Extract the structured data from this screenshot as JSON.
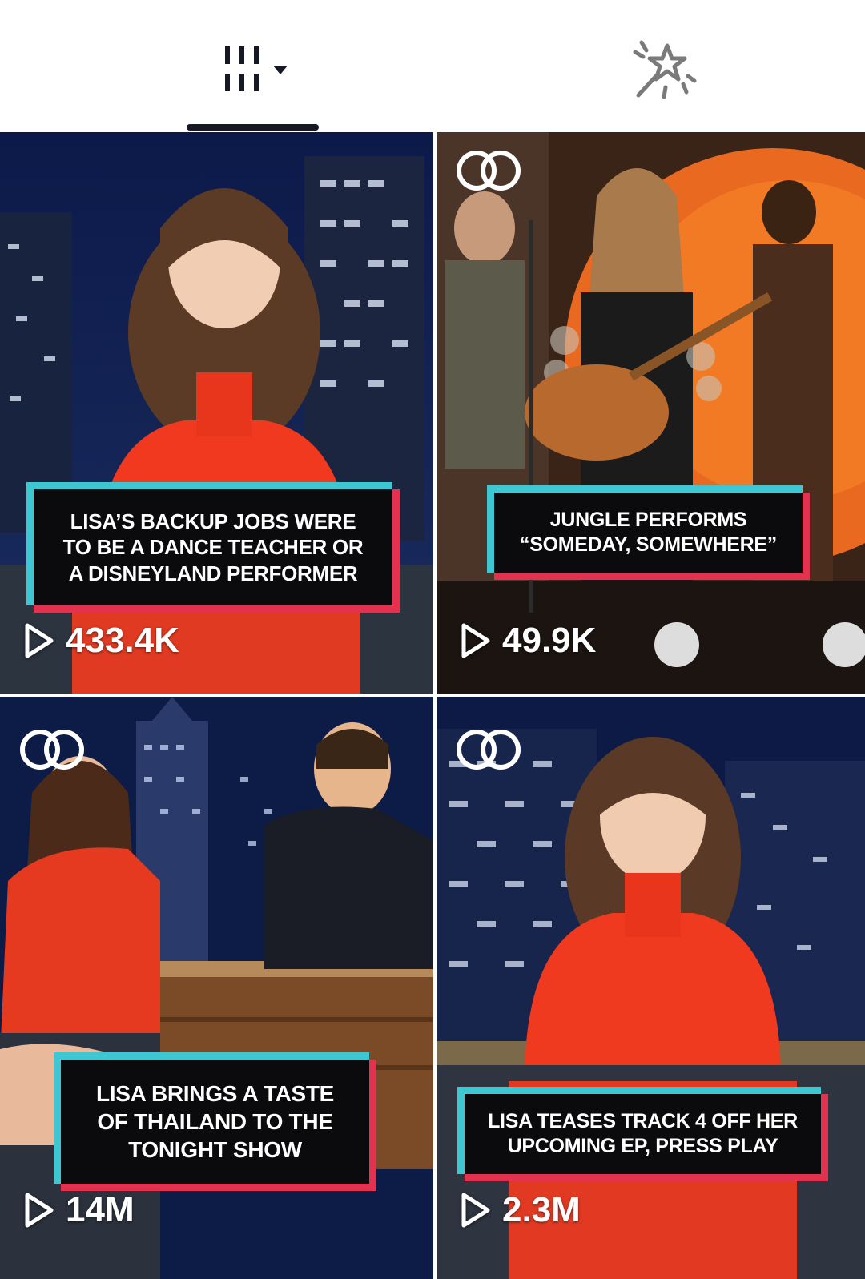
{
  "tabs": [
    {
      "name": "videos",
      "icon": "grid-bars-icon",
      "active": true
    },
    {
      "name": "effects",
      "icon": "magic-wand-icon",
      "active": false
    }
  ],
  "colors": {
    "caption_cyan": "#3ec6d3",
    "caption_red": "#e2324f",
    "caption_bg": "#0b0b0d"
  },
  "videos": [
    {
      "caption_lines": [
        "LISA’S BACKUP JOBS WERE",
        "TO BE A DANCE TEACHER OR",
        "A DISNEYLAND PERFORMER"
      ],
      "views": "433.4K",
      "co_badge": false
    },
    {
      "caption_lines": [
        "JUNGLE PERFORMS",
        "“SOMEDAY, SOMEWHERE”"
      ],
      "views": "49.9K",
      "co_badge": true
    },
    {
      "caption_lines": [
        "LISA BRINGS A TASTE",
        "OF THAILAND TO THE",
        "TONIGHT SHOW"
      ],
      "views": "14M",
      "co_badge": true
    },
    {
      "caption_lines": [
        "LISA TEASES TRACK 4 OFF HER",
        "UPCOMING EP, PRESS PLAY"
      ],
      "views": "2.3M",
      "co_badge": true
    }
  ]
}
